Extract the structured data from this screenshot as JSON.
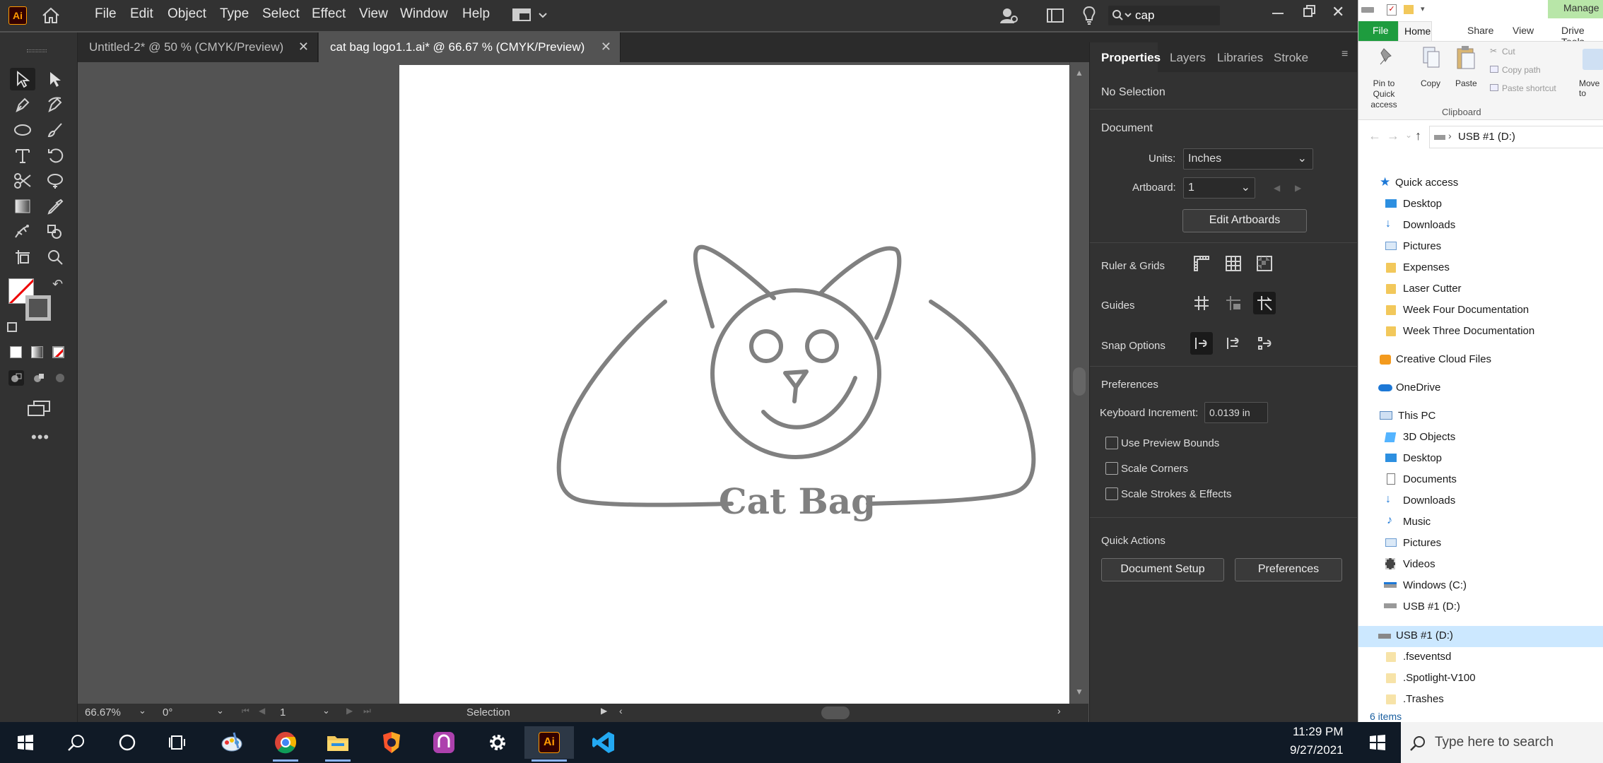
{
  "app": {
    "logo": "Ai",
    "menu": [
      "File",
      "Edit",
      "Object",
      "Type",
      "Select",
      "Effect",
      "View",
      "Window",
      "Help"
    ],
    "search_value": "cap",
    "tabs": [
      {
        "label": "Untitled-2* @ 50 % (CMYK/Preview)"
      },
      {
        "label": "cat bag logo1.1.ai* @ 66.67 % (CMYK/Preview)"
      }
    ],
    "artwork": {
      "text": "Cat Bag",
      "stroke_color": "#808080"
    },
    "status": {
      "zoom": "66.67%",
      "angle": "0°",
      "artboard": "1",
      "tool": "Selection"
    }
  },
  "panel": {
    "tabs": [
      "Properties",
      "Layers",
      "Libraries",
      "Stroke"
    ],
    "no_selection": "No Selection",
    "document_label": "Document",
    "units_label": "Units:",
    "units_value": "Inches",
    "artboard_label": "Artboard:",
    "artboard_value": "1",
    "edit_artboards": "Edit Artboards",
    "ruler_grids": "Ruler & Grids",
    "guides": "Guides",
    "snap_options": "Snap Options",
    "preferences_label": "Preferences",
    "keyboard_increment_label": "Keyboard Increment:",
    "keyboard_increment_value": "0.0139 in",
    "checkboxes": [
      "Use Preview Bounds",
      "Scale Corners",
      "Scale Strokes & Effects"
    ],
    "quick_actions": "Quick Actions",
    "document_setup": "Document Setup",
    "preferences_button": "Preferences"
  },
  "explorer": {
    "manage": "Manage",
    "ribbon_tabs": [
      "File",
      "Home",
      "Share",
      "View",
      "Drive Tools"
    ],
    "pin_label": "Pin to Quick access",
    "copy": "Copy",
    "paste": "Paste",
    "cut": "Cut",
    "copy_path": "Copy path",
    "paste_shortcut": "Paste shortcut",
    "move_to": "Move to",
    "clipboard": "Clipboard",
    "address": "USB #1 (D:)",
    "quick_access": "Quick access",
    "quick_items": [
      "Desktop",
      "Downloads",
      "Pictures",
      "Expenses",
      "Laser Cutter",
      "Week Four Documentation",
      "Week Three Documentation"
    ],
    "creative_cloud": "Creative Cloud Files",
    "onedrive": "OneDrive",
    "this_pc": "This PC",
    "pc_items": [
      "3D Objects",
      "Desktop",
      "Documents",
      "Downloads",
      "Music",
      "Pictures",
      "Videos",
      "Windows (C:)",
      "USB #1 (D:)"
    ],
    "usb_root": "USB #1 (D:)",
    "usb_items": [
      ".fseventsd",
      ".Spotlight-V100",
      ".Trashes"
    ],
    "item_count": "6 items"
  },
  "taskbar": {
    "time": "11:29 PM",
    "date": "9/27/2021",
    "search_placeholder": "Type here to search"
  }
}
